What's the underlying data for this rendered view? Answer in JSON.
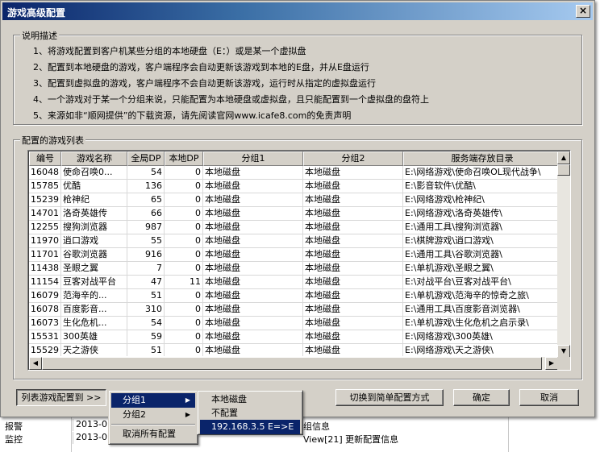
{
  "background": {
    "rows": [
      {
        "label": "报警",
        "date": "2013-0",
        "text": "组信息"
      },
      {
        "label": "监控",
        "date": "2013-0",
        "text": "View[21] 更新配置信息"
      }
    ]
  },
  "window": {
    "title": "游戏高级配置",
    "close_glyph": "×"
  },
  "description": {
    "legend": "说明描述",
    "lines": [
      "1、将游戏配置到客户机某些分组的本地硬盘（E：）或是某一个虚拟盘",
      "2、配置到本地硬盘的游戏，客户端程序会自动更新该游戏到本地的E盘，并从E盘运行",
      "3、配置到虚拟盘的游戏，客户端程序不会自动更新该游戏，运行时从指定的虚拟盘运行",
      "4、一个游戏对于某一个分组来说，只能配置为本地硬盘或虚拟盘，且只能配置到一个虚拟盘的盘符上",
      "5、来源如非“顺网提供”的下载资源，请先阅读官网www.icafe8.com的免责声明"
    ]
  },
  "game_list": {
    "legend": "配置的游戏列表",
    "columns": [
      "编号",
      "游戏名称",
      "全局DP",
      "本地DP",
      "分组1",
      "分组2",
      "服务端存放目录"
    ],
    "rows": [
      [
        "16048",
        "使命召唤0...",
        "54",
        "0",
        "本地磁盘",
        "本地磁盘",
        "E:\\网络游戏\\使命召唤OL现代战争\\"
      ],
      [
        "15785",
        "优酷",
        "136",
        "0",
        "本地磁盘",
        "本地磁盘",
        "E:\\影音软件\\优酷\\"
      ],
      [
        "15239",
        "枪神纪",
        "65",
        "0",
        "本地磁盘",
        "本地磁盘",
        "E:\\网络游戏\\枪神纪\\"
      ],
      [
        "14701",
        "洛奇英雄传",
        "66",
        "0",
        "本地磁盘",
        "本地磁盘",
        "E:\\网络游戏\\洛奇英雄传\\"
      ],
      [
        "12255",
        "搜狗浏览器",
        "987",
        "0",
        "本地磁盘",
        "本地磁盘",
        "E:\\通用工具\\搜狗浏览器\\"
      ],
      [
        "11970",
        "逍口游戏",
        "55",
        "0",
        "本地磁盘",
        "本地磁盘",
        "E:\\棋牌游戏\\逍口游戏\\"
      ],
      [
        "11701",
        "谷歌浏览器",
        "916",
        "0",
        "本地磁盘",
        "本地磁盘",
        "E:\\通用工具\\谷歌浏览器\\"
      ],
      [
        "11438",
        "圣眼之翼",
        "7",
        "0",
        "本地磁盘",
        "本地磁盘",
        "E:\\单机游戏\\圣眼之翼\\"
      ],
      [
        "11154",
        "豆客对战平台",
        "47",
        "11",
        "本地磁盘",
        "本地磁盘",
        "E:\\对战平台\\豆客对战平台\\"
      ],
      [
        "16079",
        "范海辛的...",
        "51",
        "0",
        "本地磁盘",
        "本地磁盘",
        "E:\\单机游戏\\范海辛的惊奇之旅\\"
      ],
      [
        "16078",
        "百度影音...",
        "310",
        "0",
        "本地磁盘",
        "本地磁盘",
        "E:\\通用工具\\百度影音浏览器\\"
      ],
      [
        "16073",
        "生化危机...",
        "54",
        "0",
        "本地磁盘",
        "本地磁盘",
        "E:\\单机游戏\\生化危机之启示录\\"
      ],
      [
        "15531",
        "300英雄",
        "59",
        "0",
        "本地磁盘",
        "本地磁盘",
        "E:\\网络游戏\\300英雄\\"
      ],
      [
        "15529",
        "天之游侠",
        "51",
        "0",
        "本地磁盘",
        "本地磁盘",
        "E:\\网络游戏\\天之游侠\\"
      ]
    ]
  },
  "buttons": {
    "config_list": "列表游戏配置到 >>",
    "switch_mode": "切换到简单配置方式",
    "ok": "确定",
    "cancel": "取消"
  },
  "context_menu": {
    "items": [
      "分组1",
      "分组2",
      "取消所有配置"
    ]
  },
  "submenu": {
    "items": [
      "本地磁盘",
      "不配置",
      "192.168.3.5 E=>E"
    ]
  }
}
